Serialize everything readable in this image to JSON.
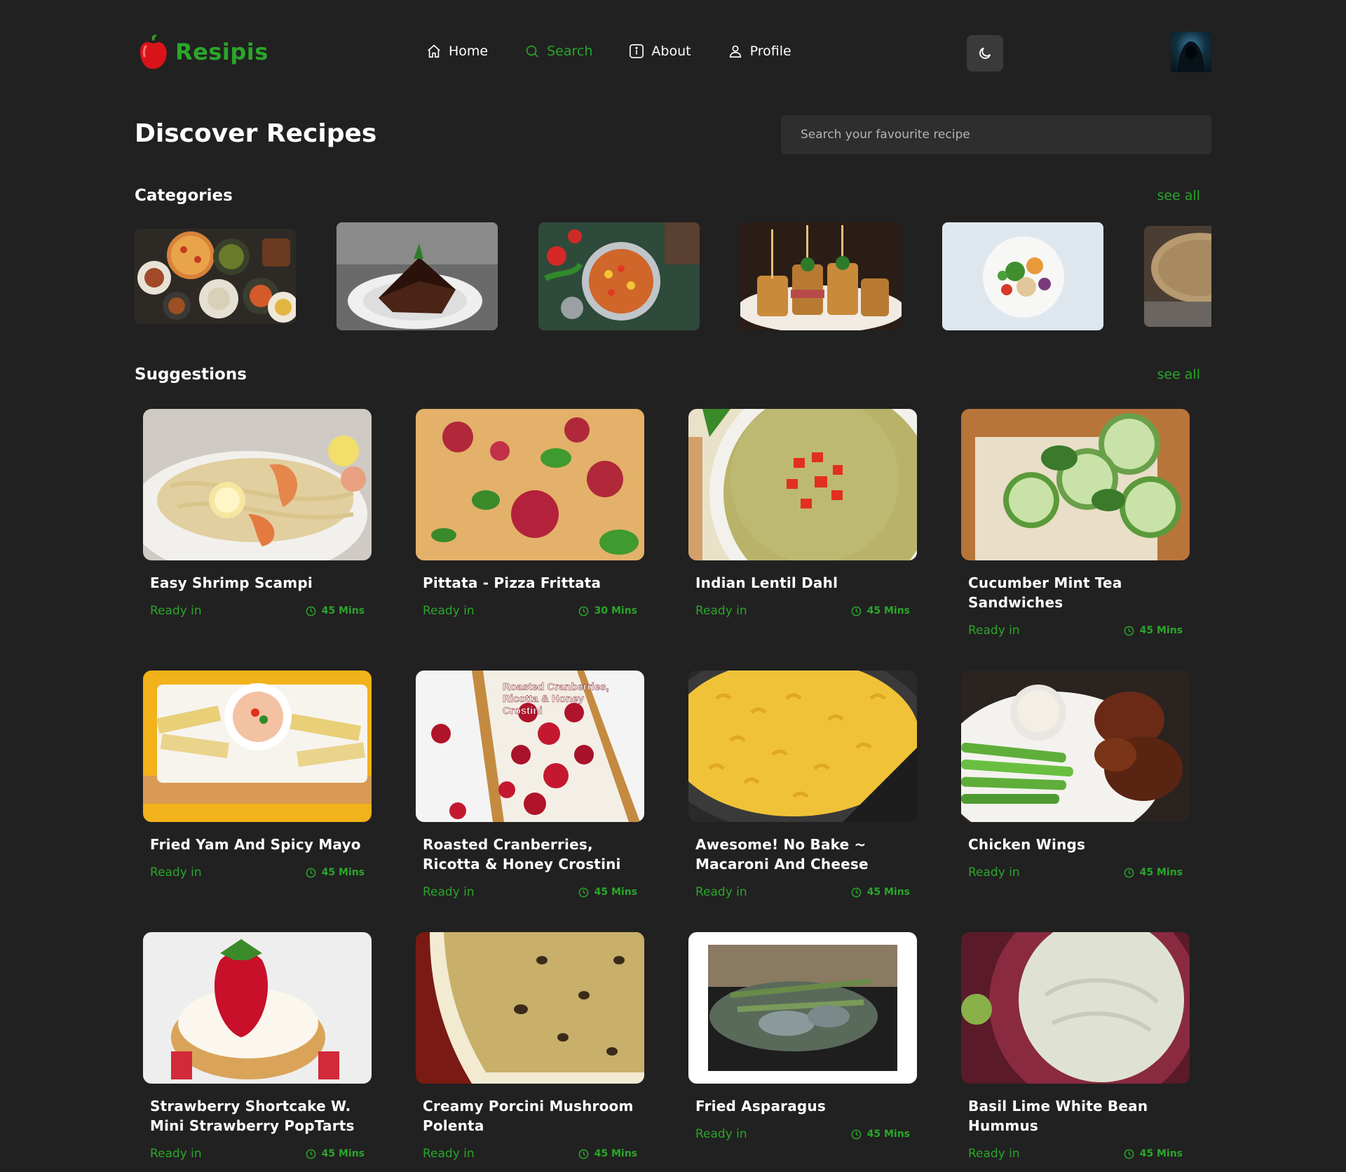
{
  "brand": {
    "name": "Resipis"
  },
  "nav": [
    {
      "label": "Home",
      "icon": "home-icon",
      "active": false
    },
    {
      "label": "Search",
      "icon": "search-icon",
      "active": true
    },
    {
      "label": "About",
      "icon": "info-icon",
      "active": false
    },
    {
      "label": "Profile",
      "icon": "user-icon",
      "active": false
    }
  ],
  "page": {
    "title": "Discover Recipes",
    "search_placeholder": "Search your favourite recipe"
  },
  "categories": {
    "title": "Categories",
    "see_all": "see all",
    "items": [
      {
        "image": "assorted-dishes"
      },
      {
        "image": "chocolate-cake"
      },
      {
        "image": "vegetable-stew"
      },
      {
        "image": "skewered-appetizers"
      },
      {
        "image": "salad-bowl"
      },
      {
        "image": "bread-loaf"
      }
    ]
  },
  "suggestions": {
    "title": "Suggestions",
    "see_all": "see all",
    "ready_label": "Ready in",
    "items": [
      {
        "title": "Easy Shrimp Scampi",
        "time": "45 Mins"
      },
      {
        "title": "Pittata - Pizza Frittata",
        "time": "30 Mins"
      },
      {
        "title": "Indian Lentil Dahl",
        "time": "45 Mins"
      },
      {
        "title": "Cucumber Mint Tea Sandwiches",
        "time": "45 Mins"
      },
      {
        "title": "Fried Yam And Spicy Mayo",
        "time": "45 Mins"
      },
      {
        "title": "Roasted Cranberries, Ricotta & Honey Crostini",
        "time": "45 Mins",
        "image_text": "Roasted Cranberries, Ricotta & Honey Crostini"
      },
      {
        "title": "Awesome! No Bake ~ Macaroni And Cheese",
        "time": "45 Mins"
      },
      {
        "title": "Chicken Wings",
        "time": "45 Mins"
      },
      {
        "title": "Strawberry Shortcake W. Mini Strawberry PopTarts",
        "time": "45 Mins"
      },
      {
        "title": "Creamy Porcini Mushroom Polenta",
        "time": "45 Mins"
      },
      {
        "title": "Fried Asparagus",
        "time": "45 Mins"
      },
      {
        "title": "Basil Lime White Bean Hummus",
        "time": "45 Mins"
      }
    ]
  },
  "colors": {
    "accent": "#2aa62a",
    "background": "#212121",
    "surface": "#2e2e2e"
  }
}
